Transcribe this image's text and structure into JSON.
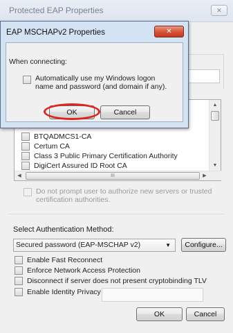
{
  "outer": {
    "title": "Protected EAP Properties",
    "close_glyph": "✕",
    "certificates": [
      "BTQADMCS1-CA",
      "Certum CA",
      "Class 3 Public Primary Certification Authority",
      "DigiCert Assured ID Root CA"
    ],
    "hscroll_thumb_glyph": "III",
    "prompt_checkbox_label": "Do not prompt user to authorize new servers or trusted certification authorities.",
    "auth_method_label": "Select Authentication Method:",
    "auth_method_selected": "Secured password (EAP-MSCHAP v2)",
    "configure_button": "Configure...",
    "options": [
      "Enable Fast Reconnect",
      "Enforce Network Access Protection",
      "Disconnect if server does not present cryptobinding TLV",
      "Enable Identity Privacy"
    ],
    "ok_button": "OK",
    "cancel_button": "Cancel"
  },
  "inner": {
    "title": "EAP MSCHAPv2 Properties",
    "close_glyph": "✕",
    "when_connecting_label": "When connecting:",
    "auto_logon_label": "Automatically use my Windows logon name and password (and domain if any).",
    "ok_button": "OK",
    "cancel_button": "Cancel"
  },
  "annotation": {
    "highlight_color": "#e0231f",
    "target": "inner-ok-button"
  }
}
